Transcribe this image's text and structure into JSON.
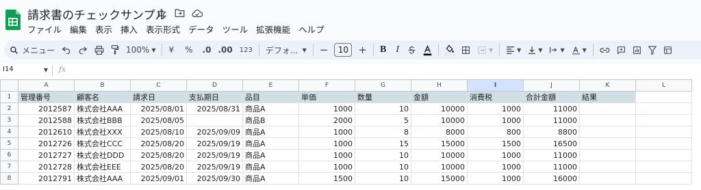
{
  "document": {
    "title": "請求書のチェックサンプル"
  },
  "menu": [
    "ファイル",
    "編集",
    "表示",
    "挿入",
    "表示形式",
    "データ",
    "ツール",
    "拡張機能",
    "ヘルプ"
  ],
  "toolbar": {
    "search_label": "メニュー",
    "zoom": "100%",
    "currency": "¥",
    "percent": "%",
    "decrease_decimal": ".0",
    "increase_decimal": ".00",
    "number_format": "123",
    "font": "デフォ...",
    "font_size": "10",
    "minus": "−",
    "plus": "+",
    "bold": "B",
    "italic": "I"
  },
  "formula_bar": {
    "cell_ref": "I14",
    "fx": "fx"
  },
  "grid": {
    "columns": [
      "A",
      "B",
      "C",
      "D",
      "E",
      "F",
      "G",
      "H",
      "I",
      "J",
      "K",
      "L"
    ],
    "selected_column": "I",
    "row_numbers": [
      "1",
      "2",
      "3",
      "4",
      "5",
      "6",
      "7",
      "8"
    ],
    "header": [
      "管理番号",
      "顧客名",
      "請求日",
      "支払期日",
      "品目",
      "単価",
      "数量",
      "金額",
      "消費税",
      "合計金額",
      "結果",
      ""
    ],
    "rows": [
      [
        "2012587",
        "株式会社AAA",
        "2025/08/01",
        "2025/08/31",
        "商品A",
        "1000",
        "10",
        "10000",
        "1000",
        "11000",
        "",
        ""
      ],
      [
        "2012588",
        "株式会社BBB",
        "2025/08/05",
        "",
        "商品B",
        "2000",
        "5",
        "10000",
        "1000",
        "11000",
        "",
        ""
      ],
      [
        "2012610",
        "株式会社XXX",
        "2025/08/10",
        "2025/09/09",
        "商品A",
        "1000",
        "8",
        "8000",
        "800",
        "8800",
        "",
        ""
      ],
      [
        "2012726",
        "株式会社CCC",
        "2025/08/20",
        "2025/09/19",
        "商品A",
        "1000",
        "15",
        "15000",
        "1500",
        "16500",
        "",
        ""
      ],
      [
        "2012727",
        "株式会社DDD",
        "2025/08/20",
        "2025/09/19",
        "商品A",
        "1000",
        "10",
        "10000",
        "1000",
        "11000",
        "",
        ""
      ],
      [
        "2012728",
        "株式会社EEE",
        "2025/08/20",
        "2025/09/19",
        "商品A",
        "1000",
        "10",
        "10000",
        "1000",
        "11000",
        "",
        ""
      ],
      [
        "2012791",
        "株式会社AAA",
        "2025/09/01",
        "2025/09/30",
        "商品A",
        "1500",
        "10",
        "15000",
        "1000",
        "16000",
        "",
        ""
      ]
    ]
  },
  "colors": {
    "header_fill": "#d0dee6",
    "selected_col": "#d3e3fd",
    "logo_green": "#0f9d58"
  }
}
